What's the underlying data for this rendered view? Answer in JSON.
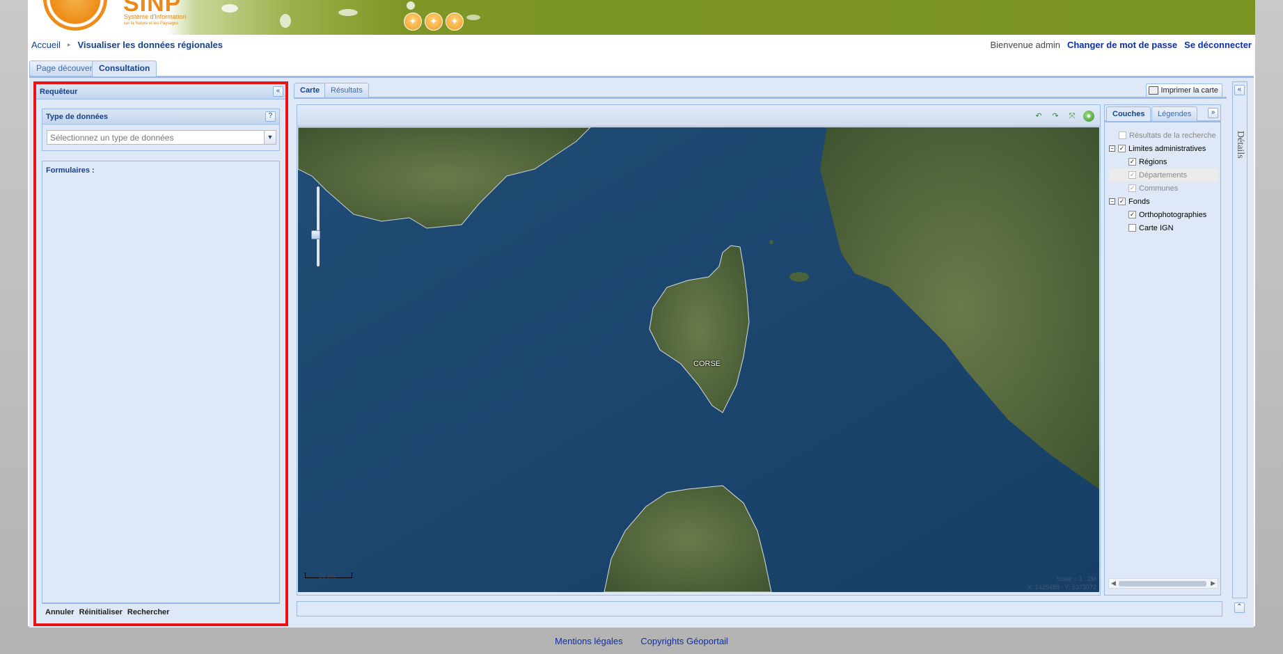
{
  "banner": {
    "logo_title": "SINP",
    "logo_subtitle1": "Système d'Information",
    "logo_subtitle2": "sur la Nature et les Paysages"
  },
  "breadcrumb": {
    "home": "Accueil",
    "current": "Visualiser les données régionales"
  },
  "user": {
    "welcome": "Bienvenue admin",
    "change_password": "Changer de mot de passe",
    "logout": "Se déconnecter"
  },
  "page_tabs": [
    {
      "label": "Page découverte",
      "active": false
    },
    {
      "label": "Consultation",
      "active": true
    }
  ],
  "requeteur": {
    "title": "Requêteur",
    "data_type_title": "Type de données",
    "data_type_placeholder": "Sélectionnez un type de données",
    "forms_label": "Formulaires :",
    "buttons": {
      "cancel": "Annuler",
      "reset": "Réinitialiser",
      "search": "Rechercher"
    }
  },
  "center_tabs": {
    "map": "Carte",
    "results": "Résultats",
    "print": "Imprimer la carte"
  },
  "map": {
    "label": "CORSE",
    "scale_bar": "50 km",
    "scale_text": "Scale = 1 : 2M",
    "coords": "X: 1425488 - Y: 5373072"
  },
  "layers": {
    "tabs": [
      "Couches",
      "Légendes"
    ],
    "tree": [
      {
        "label": "Résultats de la recherche",
        "level": 0,
        "checked": false,
        "disabled": true,
        "expander": ""
      },
      {
        "label": "Limites administratives",
        "level": 0,
        "checked": true,
        "disabled": false,
        "expander": "−"
      },
      {
        "label": "Régions",
        "level": 1,
        "checked": true,
        "disabled": false
      },
      {
        "label": "Départements",
        "level": 1,
        "checked": true,
        "disabled": true
      },
      {
        "label": "Communes",
        "level": 1,
        "checked": true,
        "disabled": true
      },
      {
        "label": "Fonds",
        "level": 0,
        "checked": true,
        "disabled": false,
        "expander": "−"
      },
      {
        "label": "Orthophotographies",
        "level": 1,
        "checked": true,
        "disabled": false
      },
      {
        "label": "Carte IGN",
        "level": 1,
        "checked": false,
        "disabled": false
      }
    ]
  },
  "details_label": "Détails",
  "footer": {
    "legal": "Mentions légales",
    "copyright": "Copyrights Géoportail"
  }
}
